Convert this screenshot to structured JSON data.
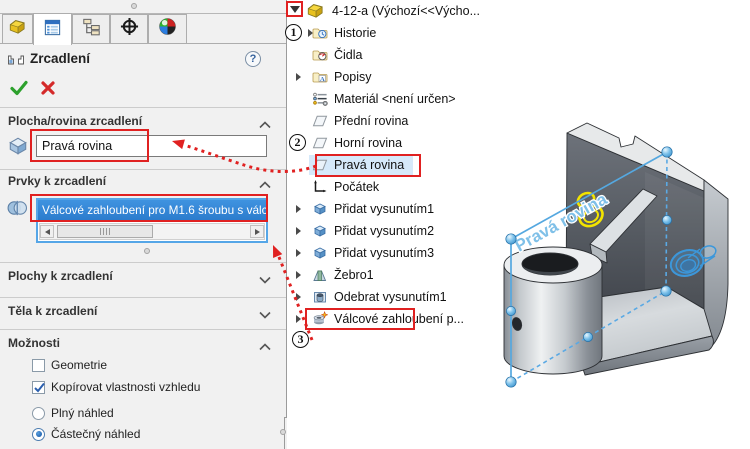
{
  "panel": {
    "title": "Zrcadlení",
    "help_label": "?",
    "tabs": [
      {
        "name": "features-tab",
        "icon": "part-icon",
        "active": false
      },
      {
        "name": "property-manager-tab",
        "icon": "property-manager-icon",
        "active": true
      },
      {
        "name": "configuration-manager-tab",
        "icon": "configurations-icon",
        "active": false
      },
      {
        "name": "dimxpert-tab",
        "icon": "dimxpert-icon",
        "active": false
      },
      {
        "name": "display-manager-tab",
        "icon": "display-manager-icon",
        "active": false
      }
    ],
    "mirror_plane_section": {
      "label": "Plocha/rovina zrcadlení",
      "value": "Pravá rovina",
      "expanded": true
    },
    "features_section": {
      "label": "Prvky k zrcadlení",
      "selected_item": "Válcové zahloubení pro M1.6 šroubu s válc",
      "expanded": true
    },
    "faces_section": {
      "label": "Plochy k zrcadlení",
      "expanded": false
    },
    "bodies_section": {
      "label": "Těla k zrcadlení",
      "expanded": false
    },
    "options_section": {
      "label": "Možnosti",
      "expanded": true,
      "checkboxes": [
        {
          "label": "Geometrie",
          "checked": false
        },
        {
          "label": "Kopírovat vlastnosti vzhledu",
          "checked": true
        }
      ],
      "radios": [
        {
          "label": "Plný náhled",
          "checked": false
        },
        {
          "label": "Částečný náhled",
          "checked": true
        }
      ]
    }
  },
  "tree": {
    "root_label": "4-12-a  (Výchozí<<Výcho...",
    "items": [
      {
        "label": "Historie",
        "icon": "history-folder",
        "expandable": true
      },
      {
        "label": "Čidla",
        "icon": "sensors-folder",
        "expandable": false
      },
      {
        "label": "Popisy",
        "icon": "annotations-folder",
        "expandable": true
      },
      {
        "label": "Materiál <není určen>",
        "icon": "material",
        "expandable": false
      },
      {
        "label": "Přední rovina",
        "icon": "plane",
        "expandable": false
      },
      {
        "label": "Horní rovina",
        "icon": "plane",
        "expandable": false
      },
      {
        "label": "Pravá rovina",
        "icon": "plane",
        "expandable": false,
        "selected": true,
        "red_box": true
      },
      {
        "label": "Počátek",
        "icon": "origin",
        "expandable": false
      },
      {
        "label": "Přidat vysunutím1",
        "icon": "boss-extrude",
        "expandable": true
      },
      {
        "label": "Přidat vysunutím2",
        "icon": "boss-extrude",
        "expandable": true
      },
      {
        "label": "Přidat vysunutím3",
        "icon": "boss-extrude",
        "expandable": true
      },
      {
        "label": "Žebro1",
        "icon": "rib",
        "expandable": true
      },
      {
        "label": "Odebrat vysunutím1",
        "icon": "cut-extrude",
        "expandable": true
      },
      {
        "label": "Válcové zahloubení p...",
        "icon": "hole-wizard",
        "expandable": true,
        "red_box": true
      }
    ]
  },
  "steps": [
    {
      "n": "1"
    },
    {
      "n": "2"
    },
    {
      "n": "3"
    }
  ],
  "viewport": {
    "plane_label": "Pravá rovina"
  },
  "colors": {
    "selection_blue": "#2f81d5",
    "focus_border_blue": "#55a6e7",
    "annotation_red": "#e02121",
    "highlight_yellow": "#f2e400",
    "preview_blue": "#3c97da",
    "tree_selection": "#d6e9fa"
  }
}
